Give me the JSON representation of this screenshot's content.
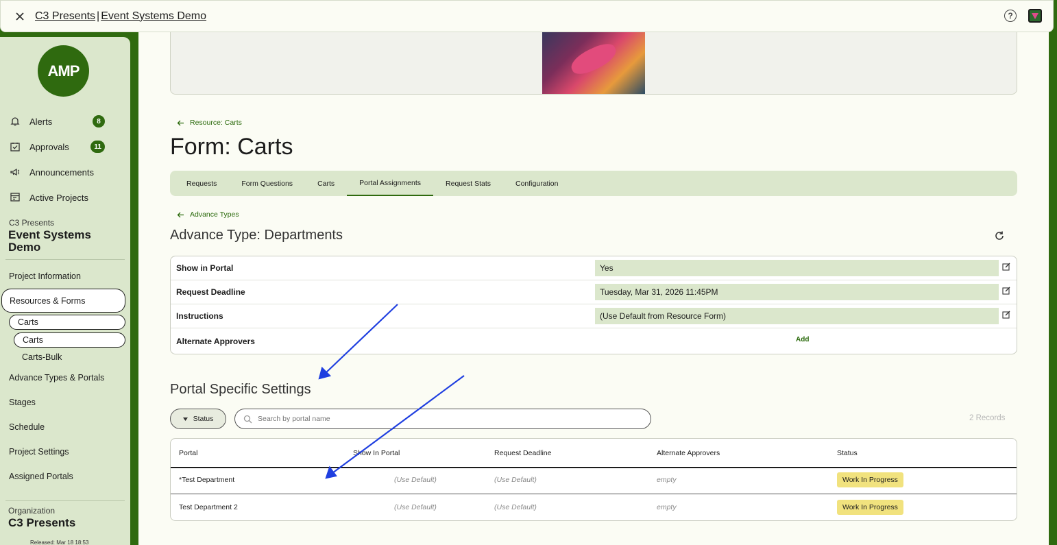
{
  "topbar": {
    "crumb_org": "C3 Presents",
    "crumb_sep": "|",
    "crumb_project": "Event Systems Demo"
  },
  "sidebar": {
    "logo_text": "AMP",
    "nav": [
      {
        "label": "Alerts",
        "badge": "8",
        "icon": "bell-icon"
      },
      {
        "label": "Approvals",
        "badge": "11",
        "icon": "checkbox-icon"
      },
      {
        "label": "Announcements",
        "badge": "",
        "icon": "megaphone-icon"
      },
      {
        "label": "Active Projects",
        "badge": "",
        "icon": "projects-icon"
      }
    ],
    "project_org": "C3 Presents",
    "project_name": "Event Systems Demo",
    "links": {
      "project_information": "Project Information",
      "resources_forms": "Resources & Forms",
      "carts_parent": "Carts",
      "carts_child": "Carts",
      "carts_bulk": "Carts-Bulk",
      "advance_types_portals": "Advance Types & Portals",
      "stages": "Stages",
      "schedule": "Schedule",
      "project_settings": "Project Settings",
      "assigned_portals": "Assigned Portals"
    },
    "org_label": "Organization",
    "org_name": "C3 Presents",
    "released": "Released: Mar 18 18:53"
  },
  "main": {
    "back_resource": "Resource: Carts",
    "form_title": "Form: Carts",
    "tabs": [
      "Requests",
      "Form Questions",
      "Carts",
      "Portal Assignments",
      "Request Stats",
      "Configuration"
    ],
    "active_tab": "Portal Assignments",
    "back_advance": "Advance Types",
    "advance_title": "Advance Type: Departments",
    "settings": [
      {
        "label": "Show in Portal",
        "value": "Yes"
      },
      {
        "label": "Request Deadline",
        "value": "Tuesday, Mar 31, 2026 11:45PM"
      },
      {
        "label": "Instructions",
        "value": "(Use Default from Resource Form)"
      },
      {
        "label": "Alternate Approvers",
        "action": "Add"
      }
    ],
    "portal_title": "Portal Specific Settings",
    "filter_label": "Status",
    "search_placeholder": "Search by portal name",
    "records": "2 Records",
    "table": {
      "headers": [
        "Portal",
        "Show In Portal",
        "Request Deadline",
        "Alternate Approvers",
        "Status"
      ],
      "rows": [
        [
          "*Test Department",
          "(Use Default)",
          "(Use Default)",
          "empty",
          "Work In Progress"
        ],
        [
          "Test Department 2",
          "(Use Default)",
          "(Use Default)",
          "empty",
          "Work In Progress"
        ]
      ]
    }
  },
  "colors": {
    "brand_green": "#2f6a0f",
    "sidebar_bg": "#dbe7cc",
    "status_chip": "#f1e27e",
    "annotation_arrow": "#1f3fe0"
  }
}
